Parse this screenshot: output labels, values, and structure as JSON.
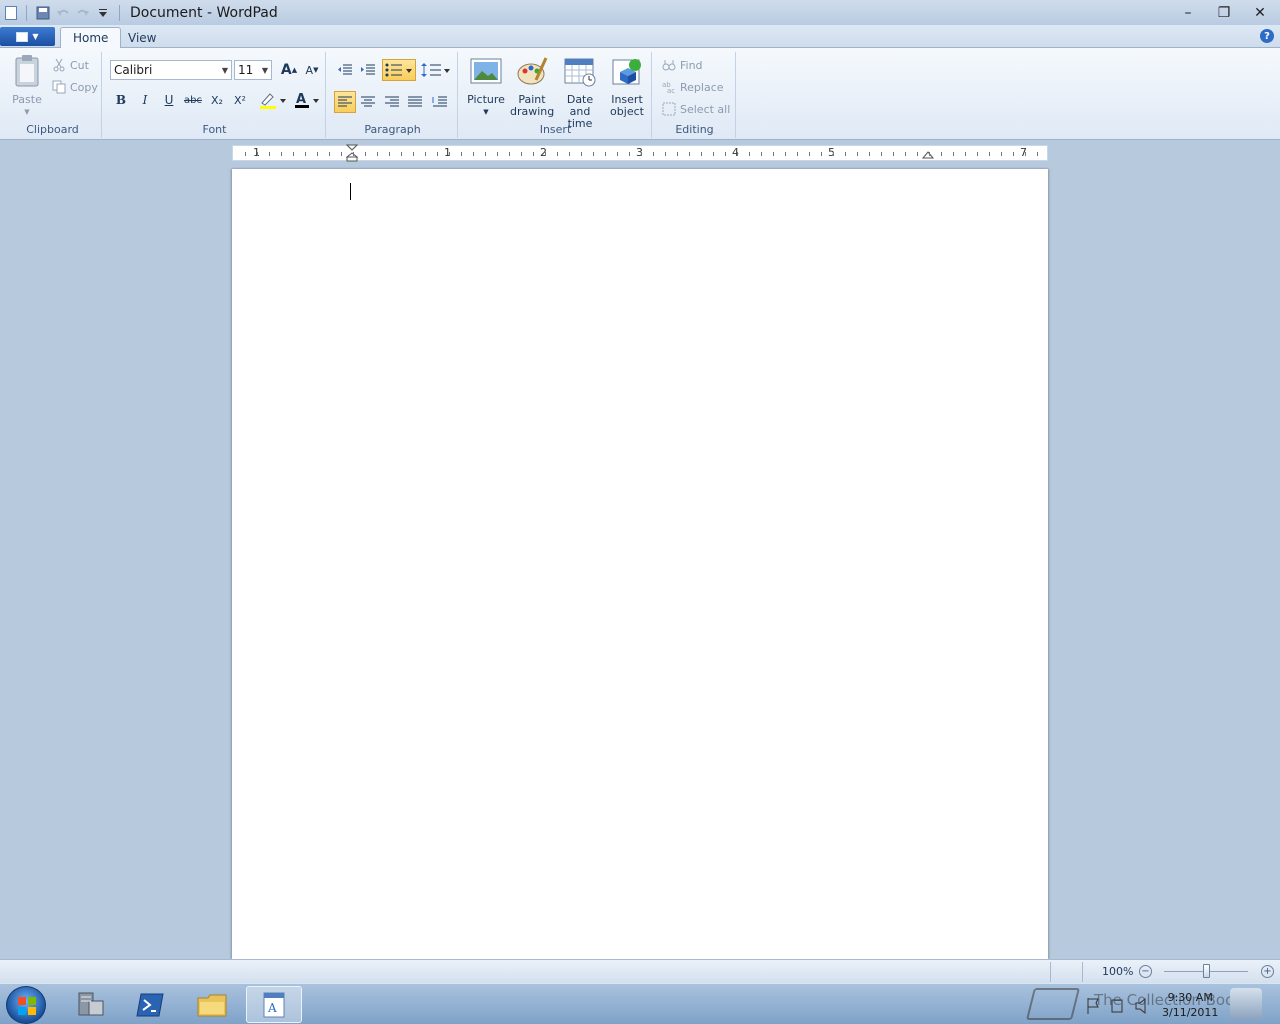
{
  "titlebar": {
    "title": "Document - WordPad",
    "controls": {
      "minimize": "–",
      "maximize": "❐",
      "close": "✕"
    }
  },
  "tabs": {
    "home": "Home",
    "view": "View"
  },
  "help_glyph": "?",
  "ribbon": {
    "clipboard": {
      "label": "Clipboard",
      "paste": "Paste",
      "cut": "Cut",
      "copy": "Copy"
    },
    "font": {
      "label": "Font",
      "family": "Calibri",
      "size": "11",
      "bold": "B",
      "italic": "I",
      "underline": "U",
      "strike": "abc",
      "subscript": "X₂",
      "superscript": "X²",
      "grow": "A",
      "shrink": "A",
      "color_glyph": "A"
    },
    "paragraph": {
      "label": "Paragraph"
    },
    "insert": {
      "label": "Insert",
      "picture": "Picture",
      "paint": [
        "Paint",
        "drawing"
      ],
      "datetime": [
        "Date and",
        "time"
      ],
      "object": [
        "Insert",
        "object"
      ]
    },
    "editing": {
      "label": "Editing",
      "find": "Find",
      "replace": "Replace",
      "select_all": "Select all"
    }
  },
  "ruler": {
    "numbers": [
      "1",
      "1",
      "2",
      "3",
      "4",
      "5",
      "7"
    ]
  },
  "statusbar": {
    "zoom": "100%",
    "zoom_out": "−",
    "zoom_in": "+",
    "zoom_fraction": 0.5
  },
  "taskbar": {
    "clock_time": "9:30 AM",
    "clock_date": "3/11/2011",
    "watermark": "The Collection Book"
  },
  "colors": {
    "ribbon_bg": "#dfe9f5",
    "active_button": "#f9cd5a",
    "font_color_bar": "#000000",
    "highlight_bar": "#ffff00"
  }
}
